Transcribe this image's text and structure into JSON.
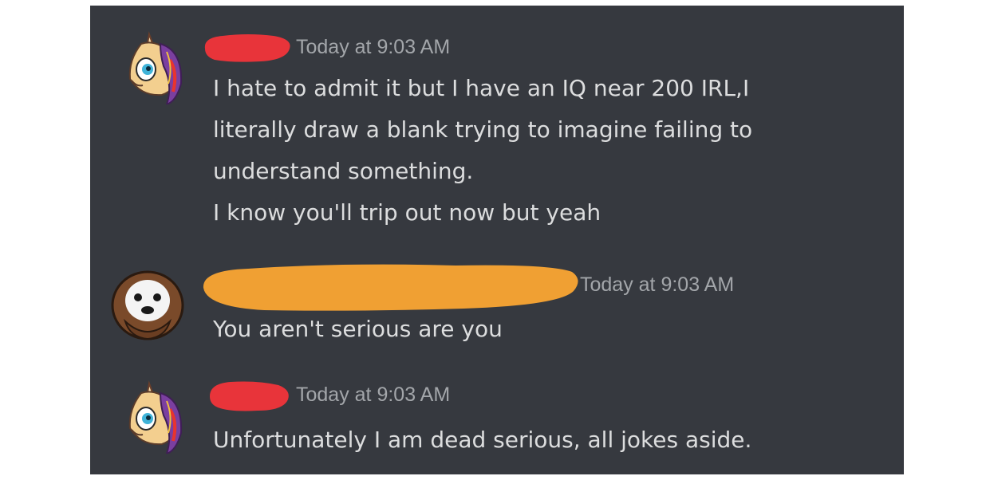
{
  "messages": [
    {
      "author_redaction_color": "#e8343a",
      "avatar": "unicorn-avatar-icon",
      "timestamp": "Today at 9:03 AM",
      "lines": [
        "I hate to admit it but I have an IQ near 200 IRL,I",
        "literally draw a blank trying to imagine failing to",
        "understand something.",
        "I know you'll trip out now but yeah"
      ]
    },
    {
      "author_redaction_color": "#f0a033",
      "avatar": "dog-avatar-icon",
      "timestamp": "Today at 9:03 AM",
      "lines": [
        "You aren't serious are you"
      ]
    },
    {
      "author_redaction_color": "#e8343a",
      "avatar": "unicorn-avatar-icon",
      "timestamp": "Today at 9:03 AM",
      "lines": [
        "Unfortunately I am dead serious, all jokes aside."
      ]
    }
  ],
  "colors": {
    "background": "#36393f",
    "text": "#dcddde",
    "timestamp": "#a3a6aa"
  }
}
